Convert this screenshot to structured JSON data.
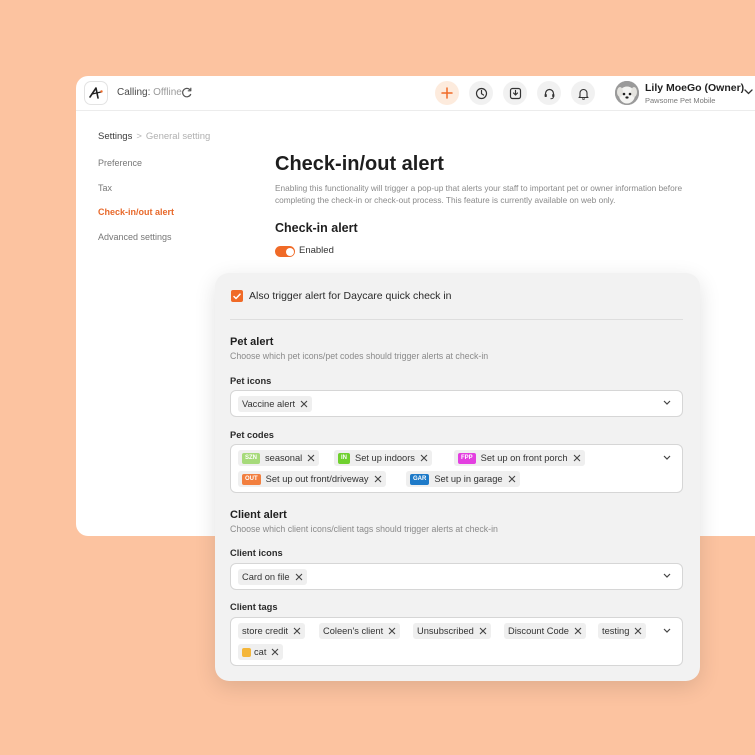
{
  "topbar": {
    "calling_label": "Calling:",
    "calling_status": "Offline",
    "user_name": "Lily MoeGo (Owner)",
    "user_company": "Pawsome Pet Mobile"
  },
  "breadcrumb": {
    "root": "Settings",
    "sep": ">",
    "current": "General setting"
  },
  "nav": [
    {
      "label": "Preference"
    },
    {
      "label": "Tax"
    },
    {
      "label": "Check-in/out alert",
      "active": true
    },
    {
      "label": "Advanced settings"
    }
  ],
  "main": {
    "title": "Check-in/out alert",
    "description": "Enabling this functionality will trigger a pop-up that alerts your staff to important pet or owner information before completing the check-in or check-out process. This feature is currently available on web only.",
    "checkin_title": "Check-in alert",
    "toggle_label": "Enabled",
    "toggle_on": true
  },
  "panel": {
    "daycare_label": "Also trigger alert for Daycare quick check in",
    "daycare_checked": true,
    "pet_alert": {
      "title": "Pet alert",
      "subtitle": "Choose which pet icons/pet codes should trigger alerts at check-in",
      "icons_label": "Pet icons",
      "icons": [
        "Vaccine alert"
      ],
      "codes_label": "Pet codes",
      "codes": [
        {
          "code": "SZN",
          "label": "seasonal",
          "color": "#A6DA7A"
        },
        {
          "code": "IN",
          "label": "Set up indoors",
          "color": "#6FD02E"
        },
        {
          "code": "FPP",
          "label": "Set up on front porch",
          "color": "#E33FE0"
        },
        {
          "code": "OUT",
          "label": "Set up out front/driveway",
          "color": "#F27F3F"
        },
        {
          "code": "GAR",
          "label": "Set up in garage",
          "color": "#1E7AC8"
        }
      ]
    },
    "client_alert": {
      "title": "Client alert",
      "subtitle": "Choose which client icons/client tags should trigger alerts at check-in",
      "icons_label": "Client icons",
      "icons": [
        "Card on file"
      ],
      "tags_label": "Client tags",
      "tags": [
        "store credit",
        "Coleen's client",
        "Unsubscribed",
        "Discount Code",
        "testing",
        "cat"
      ]
    }
  },
  "colors": {
    "accent": "#F06A27",
    "background": "#FCC3A0"
  }
}
